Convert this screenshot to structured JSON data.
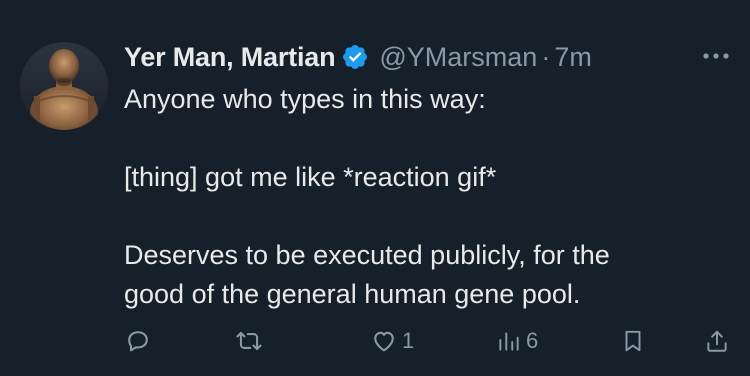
{
  "author": {
    "display_name": "Yer Man, Martian",
    "handle": "@YMarsman",
    "separator": "·",
    "time": "7m",
    "verified": true,
    "avatar": "statue-avatar"
  },
  "tweet": {
    "lines": [
      "Anyone who types in this way:",
      "",
      "[thing] got me like *reaction gif*",
      "",
      "Deserves to be executed publicly, for the",
      "good of the general human gene pool."
    ]
  },
  "actions": {
    "reply": {
      "icon": "reply-icon",
      "count": ""
    },
    "retweet": {
      "icon": "retweet-icon",
      "count": ""
    },
    "like": {
      "icon": "heart-icon",
      "count": "1"
    },
    "views": {
      "icon": "views-icon",
      "count": "6"
    },
    "bookmark": {
      "icon": "bookmark-icon"
    },
    "share": {
      "icon": "share-icon"
    }
  },
  "colors": {
    "background": "#15202b",
    "text": "#e7e9ea",
    "secondary": "#8b98a5",
    "verified": "#1d9bf0"
  }
}
